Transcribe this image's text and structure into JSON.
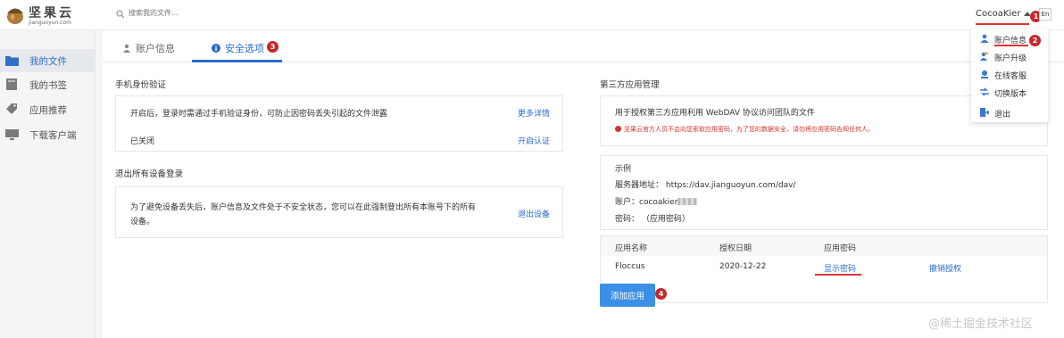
{
  "app": {
    "logo_title": "坚果云",
    "logo_sub": "jianguoyun.com"
  },
  "search": {
    "placeholder": "搜索我的文件..."
  },
  "user": {
    "name": "CocoaKier",
    "lang": "En"
  },
  "sidebar": {
    "items": [
      {
        "label": "我的文件",
        "icon": "folder-icon"
      },
      {
        "label": "我的书签",
        "icon": "bookmark-icon"
      },
      {
        "label": "应用推荐",
        "icon": "tag-icon"
      },
      {
        "label": "下载客户端",
        "icon": "monitor-icon"
      }
    ]
  },
  "tabs": [
    {
      "label": "账户信息",
      "icon": "user-icon"
    },
    {
      "label": "安全选项",
      "icon": "info-icon"
    }
  ],
  "markers": [
    "1",
    "2",
    "3",
    "4"
  ],
  "security": {
    "phone_title": "手机身份验证",
    "phone_desc": "开启后，登录时需通过手机验证身份，可防止因密码丢失引起的文件泄露",
    "phone_more": "更多详情",
    "phone_status": "已关闭",
    "phone_enable": "开启认证",
    "logout_title": "退出所有设备登录",
    "logout_desc_1": "为了避免设备丢失后，账户信息及文件处于不安全状态，您可以在此强制登出所有本账号下的所有",
    "logout_desc_2": "设备。",
    "logout_link": "退出设备"
  },
  "third_party": {
    "title": "第三方应用管理",
    "desc": "用于授权第三方应用利用 WebDAV 协议访问团队的文件",
    "warning": "坚果云官方人员不会向您索取应用密码，为了您的数据安全，请勿将应用密码告知任何人。",
    "example_title": "示例",
    "server_label": "服务器地址：",
    "server_value": "https://dav.jianguoyun.com/dav/",
    "account_label": "账户：",
    "account_value": "cocoakier",
    "password_label": "密码：",
    "password_value": "（应用密码）",
    "table": {
      "headers": [
        "应用名称",
        "授权日期",
        "应用密码"
      ],
      "rows": [
        {
          "name": "Floccus",
          "date": "2020-12-22",
          "show_pw": "显示密码",
          "revoke": "撤销授权"
        }
      ]
    },
    "add_button": "添加应用"
  },
  "dropdown": {
    "items": [
      {
        "label": "账户信息",
        "icon": "user-icon"
      },
      {
        "label": "账户升级",
        "icon": "upgrade-icon"
      },
      {
        "label": "在线客服",
        "icon": "support-icon"
      },
      {
        "label": "切换版本",
        "icon": "switch-icon"
      },
      {
        "label": "退出",
        "icon": "logout-icon"
      }
    ]
  },
  "watermark": "@稀土掘金技术社区",
  "colors": {
    "accent": "#2a6ccb",
    "marker": "#c6282b",
    "warning": "#d6322e",
    "button": "#3b8fe6"
  }
}
